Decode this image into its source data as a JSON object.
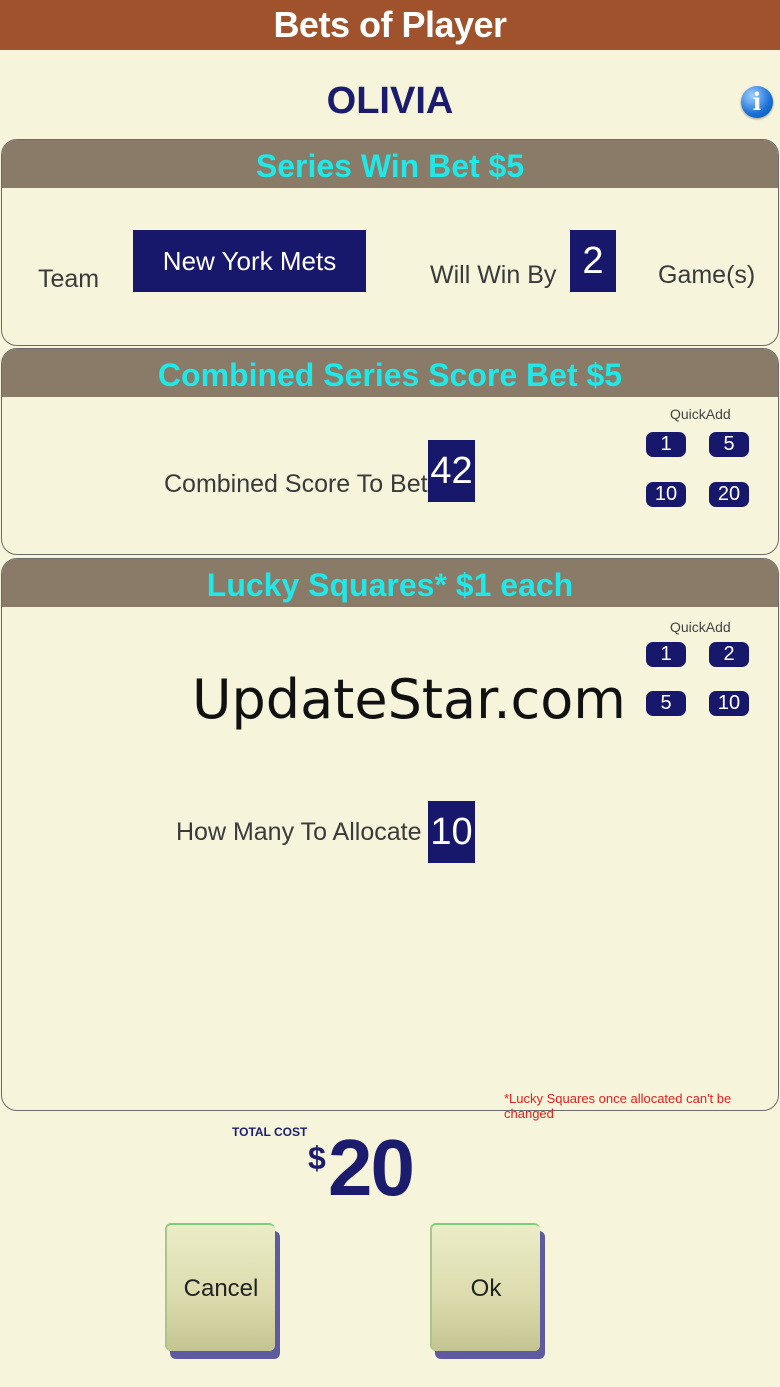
{
  "header": {
    "title": "Bets of Player"
  },
  "player": {
    "name": "OLIVIA",
    "info_icon": "info-icon"
  },
  "series_win": {
    "title": "Series Win Bet  $5",
    "team_label": "Team",
    "team_value": "New York Mets",
    "win_by_label": "Will Win By",
    "win_by_value": "2",
    "games_label": "Game(s)"
  },
  "combined": {
    "title": "Combined Series Score Bet  $5",
    "quickadd_label": "QuickAdd",
    "quickadd": [
      "1",
      "5",
      "10",
      "20"
    ],
    "score_label": "Combined Score To Bet",
    "score_value": "42"
  },
  "lucky": {
    "title": "Lucky Squares*  $1 each",
    "quickadd_label": "QuickAdd",
    "quickadd": [
      "1",
      "2",
      "5",
      "10"
    ],
    "allocate_label": "How Many To Allocate",
    "allocate_value": "10",
    "note": "*Lucky Squares once allocated can't be changed"
  },
  "watermark": "UpdateStar.com",
  "total": {
    "label": "TOTAL COST",
    "currency": "$",
    "value": "20"
  },
  "buttons": {
    "cancel": "Cancel",
    "ok": "Ok"
  },
  "colors": {
    "header_bg": "#a0522d",
    "panel_header_bg": "#8a7a68",
    "panel_title": "#1ee8e8",
    "navy": "#17176b",
    "background": "#f6f5dc"
  }
}
